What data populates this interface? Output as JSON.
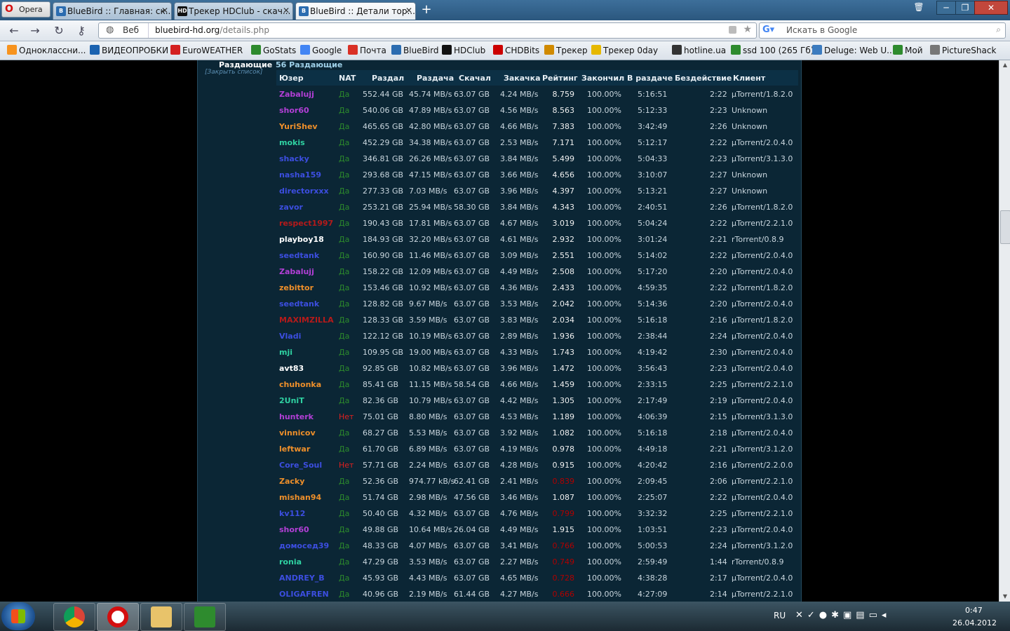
{
  "browser": {
    "opera_label": "Opera",
    "tabs": [
      {
        "title": "BlueBird :: Главная: ск...",
        "icon": "bluebird-icon",
        "active": false
      },
      {
        "title": "Трекер HDClub - скач...",
        "icon": "hdclub-icon",
        "active": false
      },
      {
        "title": "BlueBird :: Детали тор...",
        "icon": "bluebird-icon",
        "active": true
      }
    ],
    "address": {
      "label": "Веб",
      "host": "bluebird-hd.org",
      "path": "/details.php"
    },
    "search_placeholder": "Искать в Google",
    "bookmarks": [
      {
        "label": "Одноклассни...",
        "color": "#f7931e"
      },
      {
        "label": "ВИДЕОПРОБКИ",
        "color": "#1a62b0"
      },
      {
        "label": "EuroWEATHER",
        "color": "#d42020"
      },
      {
        "label": "GoStats",
        "color": "#2d8a2d"
      },
      {
        "label": "Google",
        "color": "#4285f4"
      },
      {
        "label": "Почта",
        "color": "#d93025"
      },
      {
        "label": "BlueBird",
        "color": "#2b6cb0"
      },
      {
        "label": "HDClub",
        "color": "#111111"
      },
      {
        "label": "CHDBits",
        "color": "#cc0000"
      },
      {
        "label": "Трекер",
        "color": "#d08a00"
      },
      {
        "label": "Трекер 0day",
        "color": "#e6b800"
      },
      {
        "label": "hotline.ua",
        "color": "#333333"
      },
      {
        "label": "ssd 100 (265 Гб)",
        "color": "#2e8b2e"
      },
      {
        "label": "Deluge: Web U...",
        "color": "#3b7bbf"
      },
      {
        "label": "Мой",
        "color": "#2e8b2e"
      },
      {
        "label": "PictureShack",
        "color": "#777777"
      }
    ]
  },
  "section": {
    "label": "Раздающие",
    "close_list": "[Закрыть список]",
    "count": "56 Раздающие"
  },
  "columns": [
    "Юзер",
    "NAT",
    "Раздал",
    "Раздача",
    "Скачал",
    "Закачка",
    "Рейтинг",
    "Закончил",
    "В раздаче",
    "Бездействие",
    "Клиент"
  ],
  "peers": [
    {
      "user": "Zabalujj",
      "color": "#b23fd6",
      "nat": "Да",
      "up": "552.44 GB",
      "ul": "45.74 MB/s",
      "down": "63.07 GB",
      "dl": "4.24 MB/s",
      "ratio": "8.759",
      "done": "100.00%",
      "seeding": "5:16:51",
      "idle": "2:22",
      "client": "µTorrent/1.8.2.0"
    },
    {
      "user": "shor60",
      "color": "#b23fd6",
      "nat": "Да",
      "up": "540.06 GB",
      "ul": "47.89 MB/s",
      "down": "63.07 GB",
      "dl": "4.56 MB/s",
      "ratio": "8.563",
      "done": "100.00%",
      "seeding": "5:12:33",
      "idle": "2:23",
      "client": "Unknown"
    },
    {
      "user": "YuriShev",
      "color": "#ee8f2a",
      "nat": "Да",
      "up": "465.65 GB",
      "ul": "42.80 MB/s",
      "down": "63.07 GB",
      "dl": "4.66 MB/s",
      "ratio": "7.383",
      "done": "100.00%",
      "seeding": "3:42:49",
      "idle": "2:26",
      "client": "Unknown"
    },
    {
      "user": "mokis",
      "color": "#2fd2a2",
      "nat": "Да",
      "up": "452.29 GB",
      "ul": "34.38 MB/s",
      "down": "63.07 GB",
      "dl": "2.53 MB/s",
      "ratio": "7.171",
      "done": "100.00%",
      "seeding": "5:12:17",
      "idle": "2:22",
      "client": "µTorrent/2.0.4.0"
    },
    {
      "user": "shacky",
      "color": "#3c4ee0",
      "nat": "Да",
      "up": "346.81 GB",
      "ul": "26.26 MB/s",
      "down": "63.07 GB",
      "dl": "3.84 MB/s",
      "ratio": "5.499",
      "done": "100.00%",
      "seeding": "5:04:33",
      "idle": "2:23",
      "client": "µTorrent/3.1.3.0"
    },
    {
      "user": "nasha159",
      "color": "#3c4ee0",
      "nat": "Да",
      "up": "293.68 GB",
      "ul": "47.15 MB/s",
      "down": "63.07 GB",
      "dl": "3.66 MB/s",
      "ratio": "4.656",
      "done": "100.00%",
      "seeding": "3:10:07",
      "idle": "2:27",
      "client": "Unknown"
    },
    {
      "user": "directorxxx",
      "color": "#3c4ee0",
      "nat": "Да",
      "up": "277.33 GB",
      "ul": "7.03 MB/s",
      "down": "63.07 GB",
      "dl": "3.96 MB/s",
      "ratio": "4.397",
      "done": "100.00%",
      "seeding": "5:13:21",
      "idle": "2:27",
      "client": "Unknown"
    },
    {
      "user": "zavor",
      "color": "#3c4ee0",
      "nat": "Да",
      "up": "253.21 GB",
      "ul": "25.94 MB/s",
      "down": "58.30 GB",
      "dl": "3.84 MB/s",
      "ratio": "4.343",
      "done": "100.00%",
      "seeding": "2:40:51",
      "idle": "2:26",
      "client": "µTorrent/1.8.2.0"
    },
    {
      "user": "respect1997",
      "color": "#b51a1a",
      "nat": "Да",
      "up": "190.43 GB",
      "ul": "17.81 MB/s",
      "down": "63.07 GB",
      "dl": "4.67 MB/s",
      "ratio": "3.019",
      "done": "100.00%",
      "seeding": "5:04:24",
      "idle": "2:22",
      "client": "µTorrent/2.2.1.0"
    },
    {
      "user": "playboy18",
      "color": "#ffffff",
      "nat": "Да",
      "up": "184.93 GB",
      "ul": "32.20 MB/s",
      "down": "63.07 GB",
      "dl": "4.61 MB/s",
      "ratio": "2.932",
      "done": "100.00%",
      "seeding": "3:01:24",
      "idle": "2:21",
      "client": "rTorrent/0.8.9"
    },
    {
      "user": "seedtank",
      "color": "#3c4ee0",
      "nat": "Да",
      "up": "160.90 GB",
      "ul": "11.46 MB/s",
      "down": "63.07 GB",
      "dl": "3.09 MB/s",
      "ratio": "2.551",
      "done": "100.00%",
      "seeding": "5:14:02",
      "idle": "2:22",
      "client": "µTorrent/2.0.4.0"
    },
    {
      "user": "Zabalujj",
      "color": "#b23fd6",
      "nat": "Да",
      "up": "158.22 GB",
      "ul": "12.09 MB/s",
      "down": "63.07 GB",
      "dl": "4.49 MB/s",
      "ratio": "2.508",
      "done": "100.00%",
      "seeding": "5:17:20",
      "idle": "2:20",
      "client": "µTorrent/2.0.4.0"
    },
    {
      "user": "zebittor",
      "color": "#ee8f2a",
      "nat": "Да",
      "up": "153.46 GB",
      "ul": "10.92 MB/s",
      "down": "63.07 GB",
      "dl": "4.36 MB/s",
      "ratio": "2.433",
      "done": "100.00%",
      "seeding": "4:59:35",
      "idle": "2:22",
      "client": "µTorrent/1.8.2.0"
    },
    {
      "user": "seedtank",
      "color": "#3c4ee0",
      "nat": "Да",
      "up": "128.82 GB",
      "ul": "9.67 MB/s",
      "down": "63.07 GB",
      "dl": "3.53 MB/s",
      "ratio": "2.042",
      "done": "100.00%",
      "seeding": "5:14:36",
      "idle": "2:20",
      "client": "µTorrent/2.0.4.0"
    },
    {
      "user": "MAXIMZILLA",
      "color": "#b51a1a",
      "nat": "Да",
      "up": "128.33 GB",
      "ul": "3.59 MB/s",
      "down": "63.07 GB",
      "dl": "3.83 MB/s",
      "ratio": "2.034",
      "done": "100.00%",
      "seeding": "5:16:18",
      "idle": "2:16",
      "client": "µTorrent/1.8.2.0"
    },
    {
      "user": "Vladi",
      "color": "#3c4ee0",
      "nat": "Да",
      "up": "122.12 GB",
      "ul": "10.19 MB/s",
      "down": "63.07 GB",
      "dl": "2.89 MB/s",
      "ratio": "1.936",
      "done": "100.00%",
      "seeding": "2:38:44",
      "idle": "2:24",
      "client": "µTorrent/2.0.4.0"
    },
    {
      "user": "mji",
      "color": "#2fd2a2",
      "nat": "Да",
      "up": "109.95 GB",
      "ul": "19.00 MB/s",
      "down": "63.07 GB",
      "dl": "4.33 MB/s",
      "ratio": "1.743",
      "done": "100.00%",
      "seeding": "4:19:42",
      "idle": "2:30",
      "client": "µTorrent/2.0.4.0"
    },
    {
      "user": "avt83",
      "color": "#ffffff",
      "nat": "Да",
      "up": "92.85 GB",
      "ul": "10.82 MB/s",
      "down": "63.07 GB",
      "dl": "3.96 MB/s",
      "ratio": "1.472",
      "done": "100.00%",
      "seeding": "3:56:43",
      "idle": "2:23",
      "client": "µTorrent/2.0.4.0"
    },
    {
      "user": "chuhonka",
      "color": "#ee8f2a",
      "nat": "Да",
      "up": "85.41 GB",
      "ul": "11.15 MB/s",
      "down": "58.54 GB",
      "dl": "4.66 MB/s",
      "ratio": "1.459",
      "done": "100.00%",
      "seeding": "2:33:15",
      "idle": "2:25",
      "client": "µTorrent/2.2.1.0"
    },
    {
      "user": "2UniT",
      "color": "#2fd2a2",
      "nat": "Да",
      "up": "82.36 GB",
      "ul": "10.79 MB/s",
      "down": "63.07 GB",
      "dl": "4.42 MB/s",
      "ratio": "1.305",
      "done": "100.00%",
      "seeding": "2:17:49",
      "idle": "2:19",
      "client": "µTorrent/2.0.4.0"
    },
    {
      "user": "hunterk",
      "color": "#b23fd6",
      "nat": "Нет",
      "up": "75.01 GB",
      "ul": "8.80 MB/s",
      "down": "63.07 GB",
      "dl": "4.53 MB/s",
      "ratio": "1.189",
      "done": "100.00%",
      "seeding": "4:06:39",
      "idle": "2:15",
      "client": "µTorrent/3.1.3.0"
    },
    {
      "user": "vinnicov",
      "color": "#ee8f2a",
      "nat": "Да",
      "up": "68.27 GB",
      "ul": "5.53 MB/s",
      "down": "63.07 GB",
      "dl": "3.92 MB/s",
      "ratio": "1.082",
      "done": "100.00%",
      "seeding": "5:16:18",
      "idle": "2:18",
      "client": "µTorrent/2.0.4.0"
    },
    {
      "user": "leftwar",
      "color": "#ee8f2a",
      "nat": "Да",
      "up": "61.70 GB",
      "ul": "6.89 MB/s",
      "down": "63.07 GB",
      "dl": "4.19 MB/s",
      "ratio": "0.978",
      "done": "100.00%",
      "seeding": "4:49:18",
      "idle": "2:21",
      "client": "µTorrent/3.1.2.0"
    },
    {
      "user": "Core_Soul",
      "color": "#3c4ee0",
      "nat": "Нет",
      "up": "57.71 GB",
      "ul": "2.24 MB/s",
      "down": "63.07 GB",
      "dl": "4.28 MB/s",
      "ratio": "0.915",
      "done": "100.00%",
      "seeding": "4:20:42",
      "idle": "2:16",
      "client": "µTorrent/2.2.0.0"
    },
    {
      "user": "Zacky",
      "color": "#ee8f2a",
      "nat": "Да",
      "up": "52.36 GB",
      "ul": "974.77 kB/s",
      "down": "62.41 GB",
      "dl": "2.41 MB/s",
      "ratio": "0.839",
      "done": "100.00%",
      "seeding": "2:09:45",
      "idle": "2:06",
      "client": "µTorrent/2.2.1.0",
      "low": true
    },
    {
      "user": "mishan94",
      "color": "#ee8f2a",
      "nat": "Да",
      "up": "51.74 GB",
      "ul": "2.98 MB/s",
      "down": "47.56 GB",
      "dl": "3.46 MB/s",
      "ratio": "1.087",
      "done": "100.00%",
      "seeding": "2:25:07",
      "idle": "2:22",
      "client": "µTorrent/2.0.4.0"
    },
    {
      "user": "kv112",
      "color": "#3c4ee0",
      "nat": "Да",
      "up": "50.40 GB",
      "ul": "4.32 MB/s",
      "down": "63.07 GB",
      "dl": "4.76 MB/s",
      "ratio": "0.799",
      "done": "100.00%",
      "seeding": "3:32:32",
      "idle": "2:25",
      "client": "µTorrent/2.2.1.0",
      "low": true
    },
    {
      "user": "shor60",
      "color": "#b23fd6",
      "nat": "Да",
      "up": "49.88 GB",
      "ul": "10.64 MB/s",
      "down": "26.04 GB",
      "dl": "4.49 MB/s",
      "ratio": "1.915",
      "done": "100.00%",
      "seeding": "1:03:51",
      "idle": "2:23",
      "client": "µTorrent/2.0.4.0"
    },
    {
      "user": "домосед39",
      "color": "#3c4ee0",
      "nat": "Да",
      "up": "48.33 GB",
      "ul": "4.07 MB/s",
      "down": "63.07 GB",
      "dl": "3.41 MB/s",
      "ratio": "0.766",
      "done": "100.00%",
      "seeding": "5:00:53",
      "idle": "2:24",
      "client": "µTorrent/3.1.2.0",
      "low": true
    },
    {
      "user": "ronia",
      "color": "#2fd2a2",
      "nat": "Да",
      "up": "47.29 GB",
      "ul": "3.53 MB/s",
      "down": "63.07 GB",
      "dl": "2.27 MB/s",
      "ratio": "0.749",
      "done": "100.00%",
      "seeding": "2:59:49",
      "idle": "1:44",
      "client": "rTorrent/0.8.9",
      "low": true
    },
    {
      "user": "ANDREY_B",
      "color": "#3c4ee0",
      "nat": "Да",
      "up": "45.93 GB",
      "ul": "4.43 MB/s",
      "down": "63.07 GB",
      "dl": "4.65 MB/s",
      "ratio": "0.728",
      "done": "100.00%",
      "seeding": "4:38:28",
      "idle": "2:17",
      "client": "µTorrent/2.0.4.0",
      "low": true
    },
    {
      "user": "OLIGAFREN",
      "color": "#3c4ee0",
      "nat": "Да",
      "up": "40.96 GB",
      "ul": "2.19 MB/s",
      "down": "61.44 GB",
      "dl": "4.27 MB/s",
      "ratio": "0.666",
      "done": "100.00%",
      "seeding": "4:27:09",
      "idle": "2:14",
      "client": "µTorrent/2.2.1.0",
      "low": true
    }
  ],
  "taskbar": {
    "lang": "RU",
    "time": "0:47",
    "date": "26.04.2012",
    "apps": [
      "chrome-icon",
      "opera-icon",
      "explorer-icon",
      "utorrent-icon"
    ]
  }
}
